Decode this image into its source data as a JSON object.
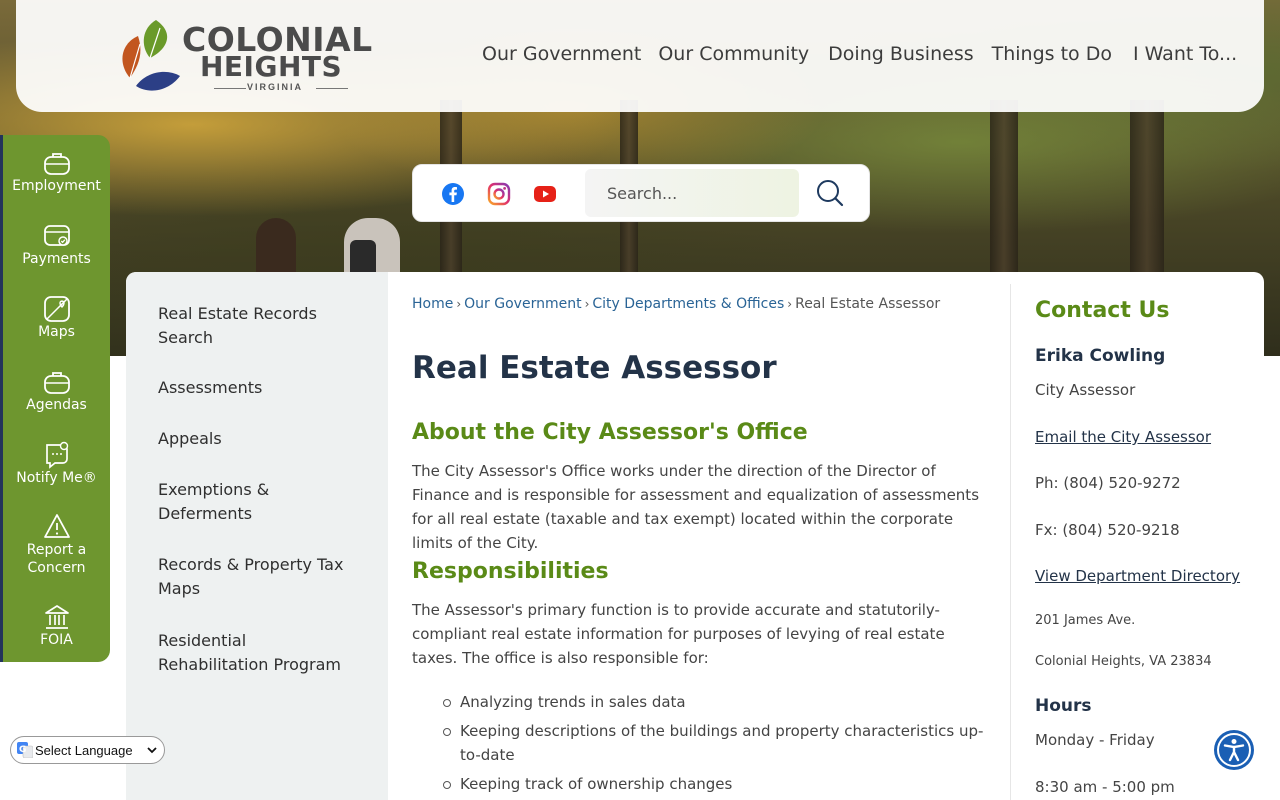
{
  "logo": {
    "line1": "COLONIAL",
    "line2": "HEIGHTS",
    "line3": "VIRGINIA"
  },
  "nav": {
    "items": [
      "Our Government",
      "Our Community",
      "Doing Business",
      "Things to Do",
      "I Want To..."
    ]
  },
  "search": {
    "placeholder": "Search..."
  },
  "social": [
    "facebook-icon",
    "instagram-icon",
    "youtube-icon"
  ],
  "quick_links": [
    {
      "label": "Employment",
      "icon": "briefcase-icon"
    },
    {
      "label": "Payments",
      "icon": "payment-card-icon"
    },
    {
      "label": "Maps",
      "icon": "map-icon"
    },
    {
      "label": "Agendas",
      "icon": "briefcase-icon"
    },
    {
      "label": "Notify Me®",
      "icon": "chat-bell-icon"
    },
    {
      "label": "Report a Concern",
      "icon": "warning-icon"
    },
    {
      "label": "FOIA",
      "icon": "building-icon"
    }
  ],
  "subnav": [
    "Real Estate Records Search",
    "Assessments",
    "Appeals",
    "Exemptions & Deferments",
    "Records & Property Tax Maps",
    "Residential Rehabilitation Program"
  ],
  "breadcrumb": {
    "items": [
      "Home",
      "Our Government",
      "City Departments & Offices"
    ],
    "current": "Real Estate Assessor",
    "separator": "›"
  },
  "page": {
    "title": "Real Estate Assessor",
    "about_heading": "About the City Assessor's Office",
    "about_text": "The City Assessor's Office works under the direction of the Director of Finance and is responsible for assessment and equalization of assessments for all real estate (taxable and tax exempt) located within the corporate limits of the City.",
    "resp_heading": "Responsibilities",
    "resp_text": "The Assessor's primary function is to provide accurate and statutorily-compliant real estate information for purposes of levying of real estate taxes. The office is also responsible for:",
    "bullets": [
      "Analyzing trends in sales data",
      "Keeping descriptions of the buildings and property characteristics up-to-date",
      "Keeping track of ownership changes"
    ]
  },
  "contact": {
    "title": "Contact Us",
    "name": "Erika Cowling",
    "role": "City Assessor",
    "email_link": "Email the City Assessor",
    "phone": "Ph: (804) 520-9272",
    "fax": "Fx: (804) 520-9218",
    "directory_link": "View Department Directory",
    "address1": "201 James Ave.",
    "address2": "Colonial Heights, VA 23834",
    "hours_heading": "Hours",
    "hours_days": "Monday - Friday",
    "hours_time": "8:30 am - 5:00 pm"
  },
  "language": {
    "label": "Select Language"
  },
  "colors": {
    "green": "#6e962f",
    "heading_green": "#5a8a17",
    "navy": "#233348",
    "link_blue": "#2a6496"
  }
}
